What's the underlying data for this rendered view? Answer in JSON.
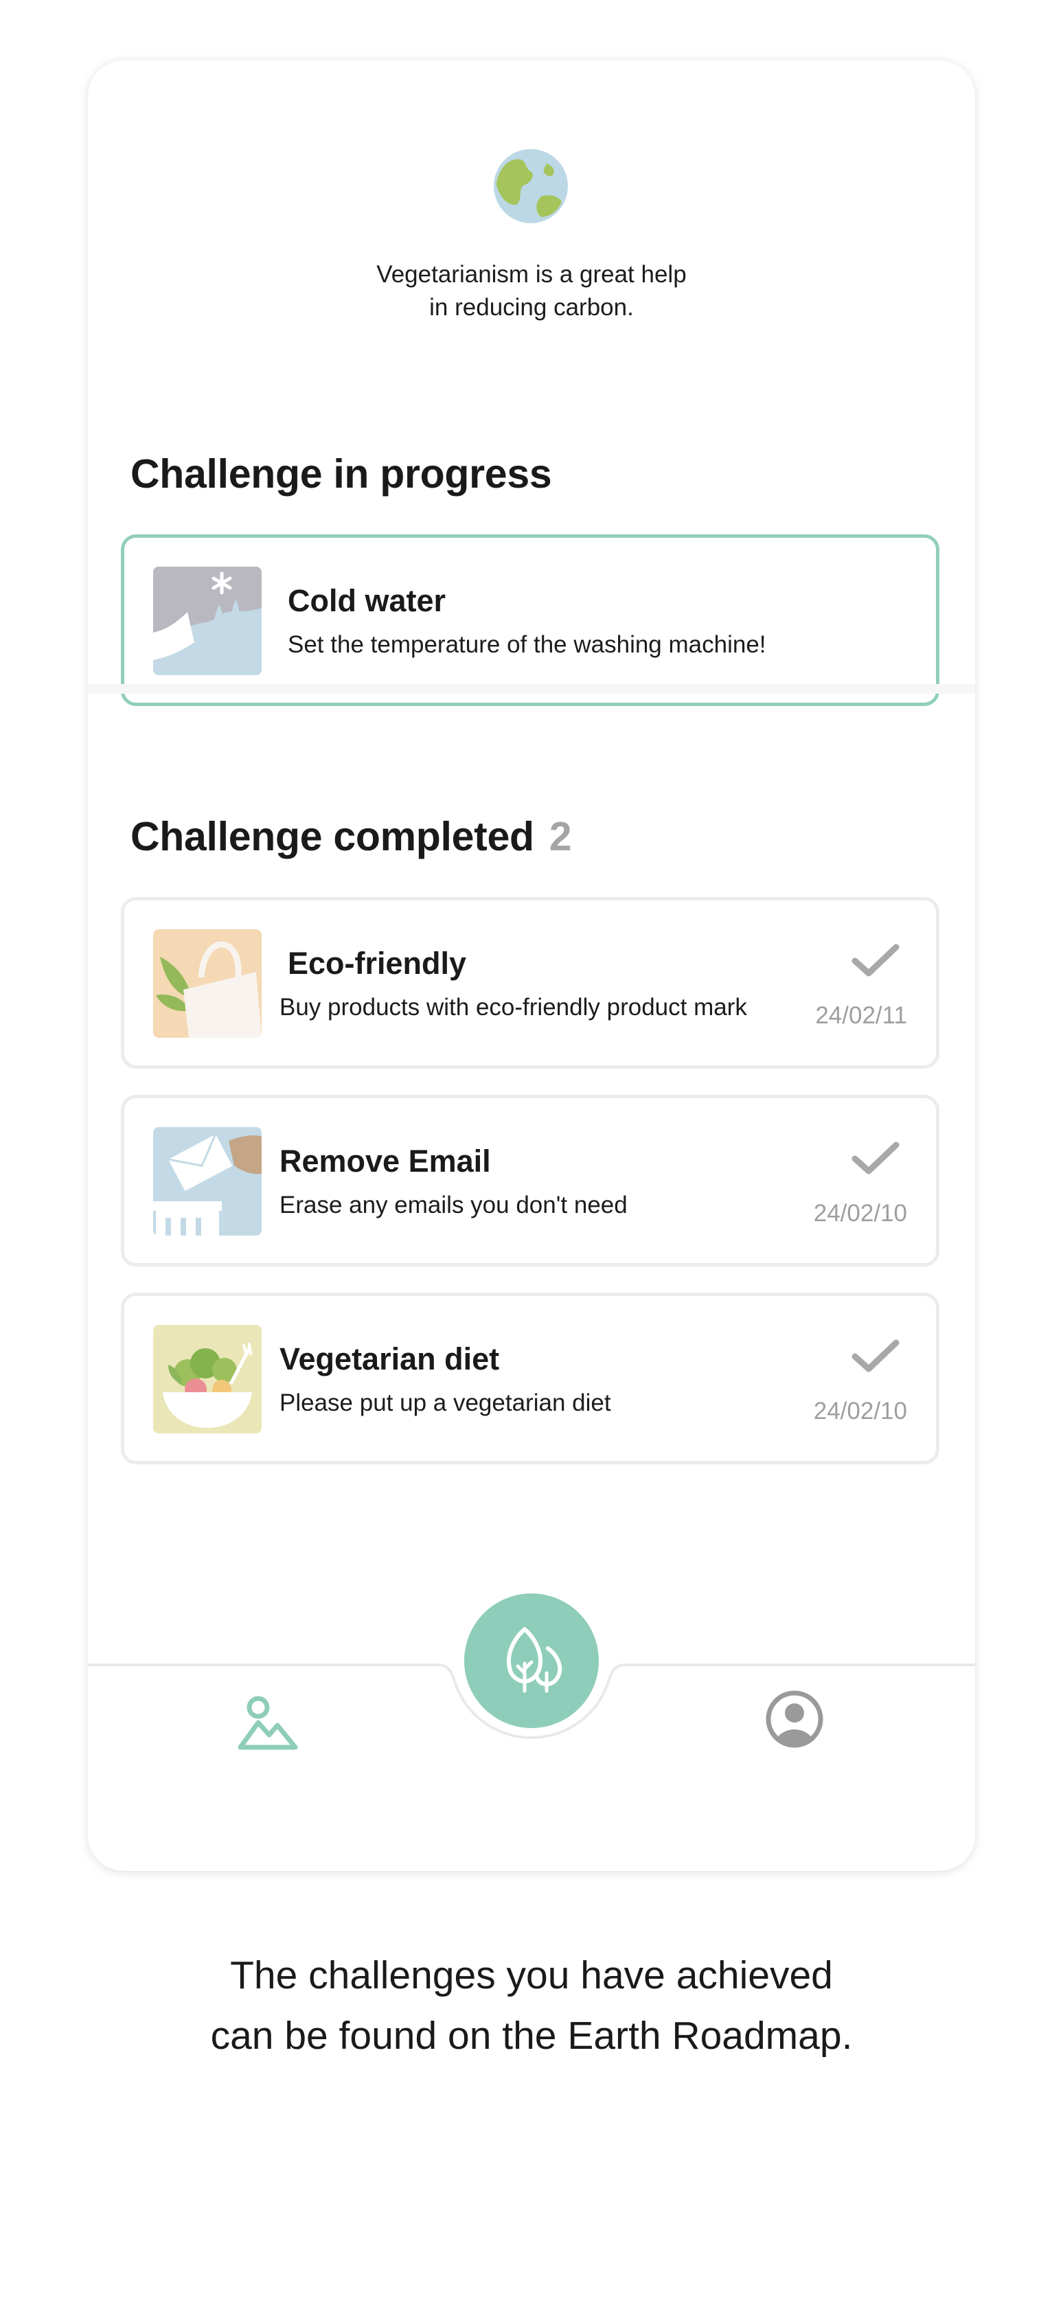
{
  "header": {
    "message_line1": "Vegetarianism is a great help",
    "message_line2": "in reducing carbon."
  },
  "in_progress": {
    "title": "Challenge in progress",
    "card": {
      "title": "Cold water",
      "description": "Set the temperature of the washing machine!"
    }
  },
  "completed": {
    "title": "Challenge completed",
    "count": "2",
    "items": [
      {
        "title": "Eco-friendly",
        "description": "Buy products with eco-friendly product mark",
        "date": "24/02/11"
      },
      {
        "title": "Remove Email",
        "description": "Erase any emails you don't need",
        "date": "24/02/10"
      },
      {
        "title": "Vegetarian diet",
        "description": "Please put up a vegetarian diet",
        "date": "24/02/10"
      }
    ]
  },
  "nav": {
    "left_icon": "roadmap-icon",
    "center_icon": "trees-icon",
    "right_icon": "profile-icon"
  },
  "footer": {
    "line1": "The challenges you have achieved",
    "line2": "can be found on the Earth Roadmap."
  },
  "colors": {
    "accent": "#8ecdb9",
    "muted": "#9e9e9e",
    "check": "#a8a8a8"
  }
}
